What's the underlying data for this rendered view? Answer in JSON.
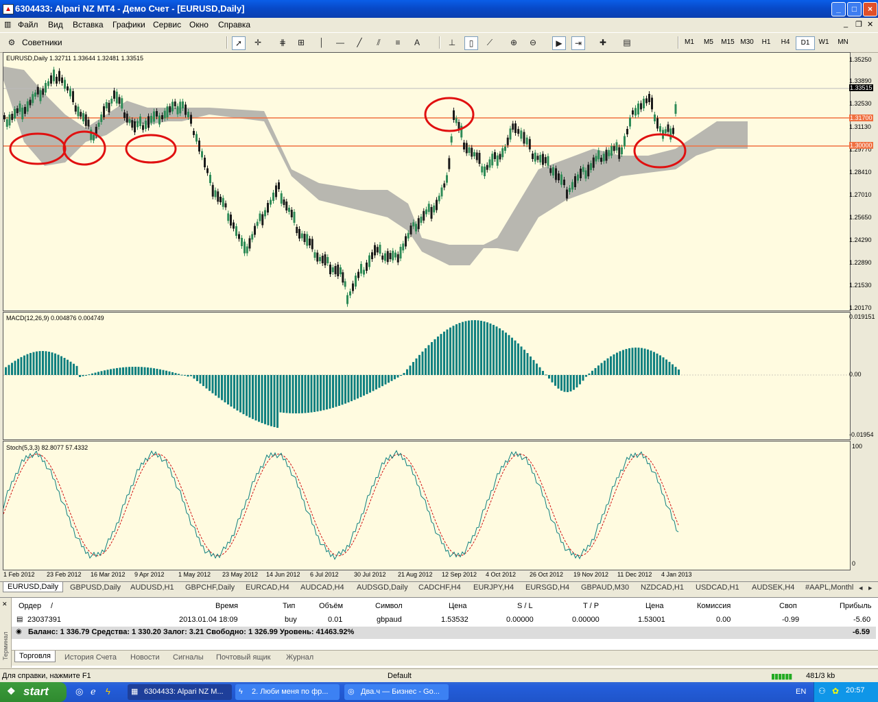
{
  "window": {
    "title": "6304433: Alpari NZ MT4 - Демо Счет - [EURUSD,Daily]",
    "app_icon": "metatrader-icon",
    "controls": [
      "_",
      "□",
      "×"
    ]
  },
  "menu": {
    "items": [
      "Файл",
      "Вид",
      "Вставка",
      "Графики",
      "Сервис",
      "Окно",
      "Справка"
    ]
  },
  "toolbar": {
    "advisors_label": "Советники",
    "timeframes": [
      "M1",
      "M5",
      "M15",
      "M30",
      "H1",
      "H4",
      "D1",
      "W1",
      "MN"
    ],
    "active_timeframe": "D1",
    "text_tool": "A"
  },
  "chart": {
    "info": "EURUSD,Daily  1.32711 1.33644 1.32481 1.33515",
    "price_axis": [
      "1.35250",
      "1.33890",
      "1.32530",
      "1.31130",
      "1.29770",
      "1.28410",
      "1.27010",
      "1.25650",
      "1.24290",
      "1.22890",
      "1.21530",
      "1.20170"
    ],
    "current_price": "1.33515",
    "hlines": [
      "1.31700",
      "1.30000"
    ],
    "macd_label": "MACD(12,26,9) 0.004876 0.004749",
    "macd_axis": [
      "0.019151",
      "0.00",
      "-0.01954"
    ],
    "stoch_label": "Stoch(5,3,3) 82.8077 57.4332",
    "stoch_axis": [
      "100",
      "0"
    ],
    "time_axis": [
      "1 Feb 2012",
      "23 Feb 2012",
      "16 Mar 2012",
      "9 Apr 2012",
      "1 May 2012",
      "23 May 2012",
      "14 Jun 2012",
      "6 Jul 2012",
      "30 Jul 2012",
      "21 Aug 2012",
      "12 Sep 2012",
      "4 Oct 2012",
      "26 Oct 2012",
      "19 Nov 2012",
      "11 Dec 2012",
      "4 Jan 2013"
    ],
    "colors": {
      "bg": "#fffbe0",
      "bull": "#2e8b57",
      "bear": "#1a1a1a",
      "kumo": "#a0a0a0",
      "hline": "#f07040",
      "macd": "#0d7f7f",
      "annot": "#e01010"
    }
  },
  "symbol_tabs": [
    "EURUSD,Daily",
    "GBPUSD,Daily",
    "AUDUSD,H1",
    "GBPCHF,Daily",
    "EURCAD,H4",
    "AUDCAD,H4",
    "AUDSGD,Daily",
    "CADCHF,H4",
    "EURJPY,H4",
    "EURSGD,H4",
    "GBPAUD,M30",
    "NZDCAD,H1",
    "USDCAD,H1",
    "AUDSEK,H4",
    "#AAPL,Monthl"
  ],
  "terminal": {
    "side_label": "Терминал",
    "headers": [
      "Ордер",
      "/",
      "Время",
      "Тип",
      "Объём",
      "Символ",
      "Цена",
      "S / L",
      "T / P",
      "Цена",
      "Комиссия",
      "Своп",
      "Прибыль"
    ],
    "order": {
      "id": "23037391",
      "time": "2013.01.04 18:09",
      "type": "buy",
      "volume": "0.01",
      "symbol": "gbpaud",
      "price": "1.53532",
      "sl": "0.00000",
      "tp": "0.00000",
      "cur_price": "1.53001",
      "commission": "0.00",
      "swap": "-0.99",
      "profit": "-5.60"
    },
    "balance_line": "Баланс: 1 336.79  Средства: 1 330.20  Залог: 3.21  Свободно: 1 326.99  Уровень: 41463.92%",
    "total_profit": "-6.59",
    "tabs": [
      "Торговля",
      "История Счета",
      "Новости",
      "Сигналы",
      "Почтовый ящик",
      "Журнал"
    ]
  },
  "status": {
    "help": "Для справки, нажмите F1",
    "profile": "Default",
    "traffic": "481/3 kb"
  },
  "taskbar": {
    "start": "start",
    "tasks": [
      "6304433: Alpari NZ M...",
      "2. Люби меня по фр...",
      "Два.ч — Бизнес - Go..."
    ],
    "lang": "EN",
    "clock": "20:57"
  }
}
